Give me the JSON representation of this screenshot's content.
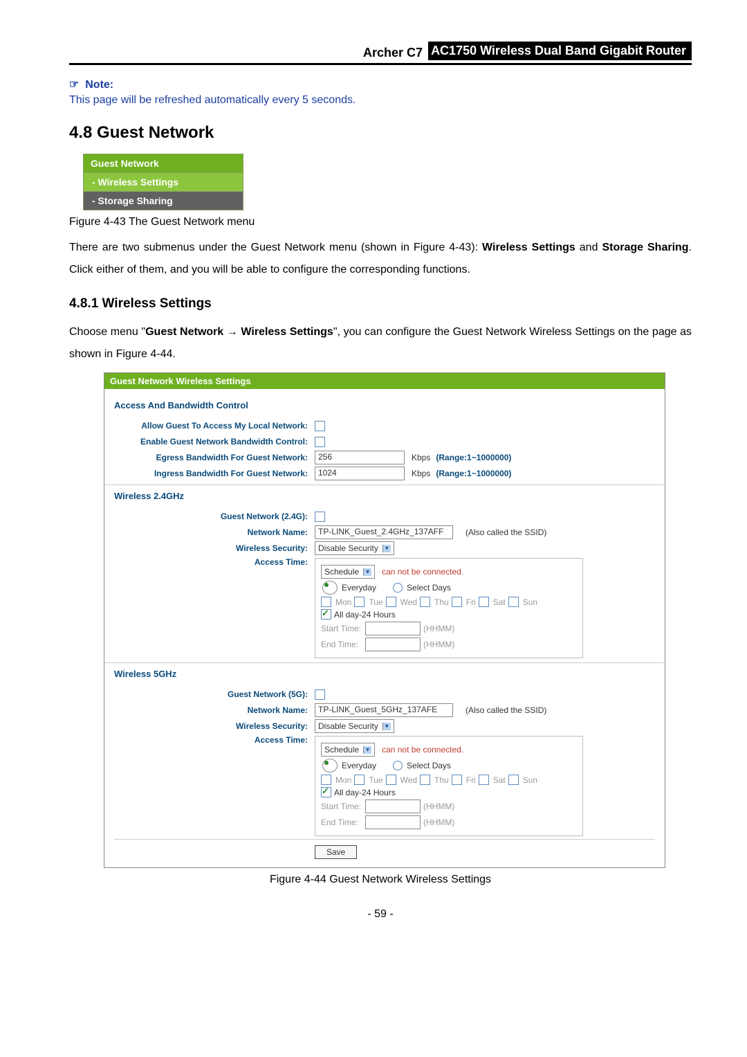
{
  "header": {
    "model": "Archer C7",
    "desc": "AC1750 Wireless Dual Band Gigabit Router"
  },
  "note": {
    "label": "Note:",
    "text": "This page will be refreshed automatically every 5 seconds."
  },
  "sec": {
    "num_title": "4.8   Guest Network"
  },
  "menu": {
    "title": "Guest Network",
    "item1": "- Wireless Settings",
    "item2": "- Storage Sharing"
  },
  "fig43_caption": "Figure 4-43 The Guest Network menu",
  "para1_a": "There are two submenus under the Guest Network menu (shown in Figure 4-43): ",
  "para1_b": "Wireless Settings",
  "para1_c": " and ",
  "para1_d": "Storage Sharing",
  "para1_e": ". Click either of them, and you will be able to configure the corresponding functions.",
  "subsec": {
    "num_title": "4.8.1     Wireless Settings"
  },
  "para2_a": "Choose menu \"",
  "para2_b": "Guest Network",
  "para2_arrow": " → ",
  "para2_c": "Wireless Settings",
  "para2_d": "\", you can configure the Guest Network Wireless Settings on the page as shown in Figure 4-44.",
  "panel": {
    "title": "Guest Network Wireless Settings",
    "group_access": "Access And Bandwidth Control",
    "lbl_allow": "Allow Guest To Access My Local Network:",
    "lbl_enable_bw": "Enable Guest Network Bandwidth Control:",
    "lbl_egress": "Egress Bandwidth For Guest Network:",
    "egress_val": "256",
    "lbl_ingress": "Ingress Bandwidth For Guest Network:",
    "ingress_val": "1024",
    "kbps": "Kbps",
    "range": "(Range:1~1000000)",
    "group_24": "Wireless 2.4GHz",
    "lbl_gn24": "Guest Network (2.4G):",
    "lbl_nn": "Network Name:",
    "nn24_val": "TP-LINK_Guest_2.4GHz_137AFF",
    "ssid_hint": "(Also called the SSID)",
    "lbl_ws": "Wireless Security:",
    "ws_val": "Disable Security",
    "lbl_at": "Access Time:",
    "at_sel": "Schedule",
    "at_warn": "can not be connected.",
    "every": "Everyday",
    "seldays": "Select Days",
    "d_mon": "Mon",
    "d_tue": "Tue",
    "d_wed": "Wed",
    "d_thu": "Thu",
    "d_fri": "Fri",
    "d_sat": "Sat",
    "d_sun": "Sun",
    "allday": "All day-24 Hours",
    "start": "Start Time:",
    "end": "End Time:",
    "hhmm": "(HHMM)",
    "group_5": "Wireless 5GHz",
    "lbl_gn5": "Guest Network (5G):",
    "nn5_val": "TP-LINK_Guest_5GHz_137AFE",
    "save": "Save"
  },
  "fig44_caption": "Figure 4-44 Guest Network Wireless Settings",
  "page_number": "- 59 -"
}
